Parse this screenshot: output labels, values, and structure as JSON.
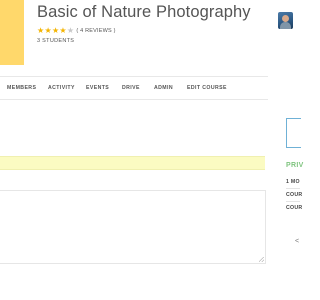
{
  "course": {
    "title": "Basic of Nature Photography",
    "rating": {
      "value": 4,
      "max": 5
    },
    "reviews_text": "( 4 REVIEWS )",
    "students_text": "3 STUDENTS",
    "accent_color": "#ffd86b"
  },
  "nav": {
    "tabs": [
      {
        "label": "MEMBERS"
      },
      {
        "label": "ACTIVITY"
      },
      {
        "label": "EVENTS"
      },
      {
        "label": "DRIVE"
      },
      {
        "label": "ADMIN"
      },
      {
        "label": "EDIT COURSE"
      }
    ]
  },
  "sidebar": {
    "heading": "PRIV",
    "rows": [
      "1 MO",
      "COUR",
      "COUR"
    ],
    "icon": "share-icon"
  },
  "colors": {
    "star": "#f4b400",
    "notice_bg": "#fbfbc2",
    "sidebar_heading": "#7fc47f",
    "sidebar_box_border": "#6fb1d6"
  }
}
